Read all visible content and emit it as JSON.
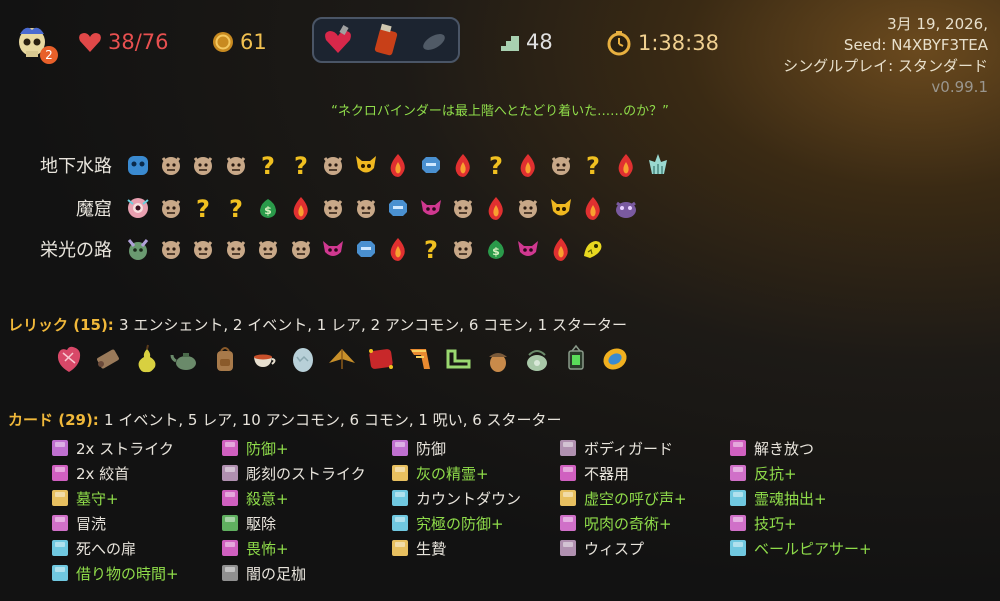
{
  "topbar": {
    "hp": "38/76",
    "gold": "61",
    "floor": "48",
    "timer": "1:38:38",
    "portrait_badge": "2",
    "potions": [
      "potion-heart-icon",
      "potion-flask-icon",
      "potion-empty-icon"
    ]
  },
  "run_info": {
    "date": "3月 19, 2026,",
    "seed": "Seed: N4XBYF3TEA",
    "mode": "シングルプレイ: スタンダード",
    "version": "v0.99.1"
  },
  "quote": "“ネクロバインダーは最上階へとたどり着いた……のか？”",
  "acts": [
    {
      "name": "地下水路",
      "nodes": [
        "boss-blue",
        "monster",
        "monster",
        "monster",
        "unknown",
        "unknown",
        "monster",
        "elite-gold",
        "rest",
        "treasure",
        "rest",
        "unknown",
        "rest",
        "monster",
        "unknown",
        "rest",
        "boss-spike"
      ]
    },
    {
      "name": "魔窟",
      "nodes": [
        "boss-eye",
        "monster",
        "unknown",
        "unknown",
        "shop",
        "rest",
        "monster",
        "monster",
        "treasure",
        "elite",
        "monster",
        "rest",
        "monster",
        "elite-gold",
        "rest",
        "boss-purple"
      ]
    },
    {
      "name": "栄光の路",
      "nodes": [
        "boss-beetle",
        "monster",
        "monster",
        "monster",
        "monster",
        "monster",
        "elite",
        "treasure",
        "rest",
        "unknown",
        "monster",
        "shop",
        "elite",
        "rest",
        "boss-worm"
      ]
    }
  ],
  "relics": {
    "title": "レリック (15):",
    "desc": "3 エンシェント, 2 イベント, 1 レア, 2 アンコモン, 6 コモン, 1 スターター",
    "items": [
      "anatomical-heart-icon",
      "scroll-icon",
      "pear-icon",
      "teapot-icon",
      "backpack-icon",
      "teacup-icon",
      "egg-icon",
      "paper-crane-icon",
      "pillow-icon",
      "scarf-icon",
      "boomerang-icon",
      "acorn-icon",
      "kettle-icon",
      "lantern-icon",
      "coin-stack-icon"
    ]
  },
  "cards": {
    "title": "カード (29):",
    "desc": "1 イベント, 5 レア, 10 アンコモン, 6 コモン, 1 呪い, 6 スターター",
    "columns": [
      [
        {
          "name": "2x ストライク",
          "up": false,
          "color": "#c070d0"
        },
        {
          "name": "2x 絞首",
          "up": false,
          "color": "#d060c0"
        },
        {
          "name": "墓守+",
          "up": true,
          "color": "#e8c060"
        },
        {
          "name": "冒涜",
          "up": false,
          "color": "#d070c8"
        },
        {
          "name": "死への扉",
          "up": false,
          "color": "#70c8e0"
        },
        {
          "name": "借り物の時間+",
          "up": true,
          "color": "#70c8e0"
        }
      ],
      [
        {
          "name": "防御+",
          "up": true,
          "color": "#d060c0"
        },
        {
          "name": "彫刻のストライク",
          "up": false,
          "color": "#b090b0"
        },
        {
          "name": "殺意+",
          "up": true,
          "color": "#d060c0"
        },
        {
          "name": "駆除",
          "up": false,
          "color": "#60b060"
        },
        {
          "name": "畏怖+",
          "up": true,
          "color": "#d060c0"
        },
        {
          "name": "闇の足枷",
          "up": false,
          "color": "#909090"
        }
      ],
      [
        {
          "name": "防御",
          "up": false,
          "color": "#c070d0"
        },
        {
          "name": "灰の精霊+",
          "up": true,
          "color": "#e8c060"
        },
        {
          "name": "カウントダウン",
          "up": false,
          "color": "#70c8e0"
        },
        {
          "name": "究極の防御+",
          "up": true,
          "color": "#70c8e0"
        },
        {
          "name": "生贄",
          "up": false,
          "color": "#e8c060"
        }
      ],
      [
        {
          "name": "ボディガード",
          "up": false,
          "color": "#b090b0"
        },
        {
          "name": "不器用",
          "up": false,
          "color": "#d060c0"
        },
        {
          "name": "虚空の呼び声+",
          "up": true,
          "color": "#e8c060"
        },
        {
          "name": "呪肉の奇術+",
          "up": true,
          "color": "#d070c8"
        },
        {
          "name": "ウィスプ",
          "up": false,
          "color": "#b090b0"
        }
      ],
      [
        {
          "name": "解き放つ",
          "up": false,
          "color": "#d060c0"
        },
        {
          "name": "反抗+",
          "up": true,
          "color": "#d070c8"
        },
        {
          "name": "霊魂抽出+",
          "up": true,
          "color": "#70c8e0"
        },
        {
          "name": "技巧+",
          "up": true,
          "color": "#d070c8"
        },
        {
          "name": "ベールピアサー+",
          "up": true,
          "color": "#70c8e0"
        }
      ]
    ]
  }
}
